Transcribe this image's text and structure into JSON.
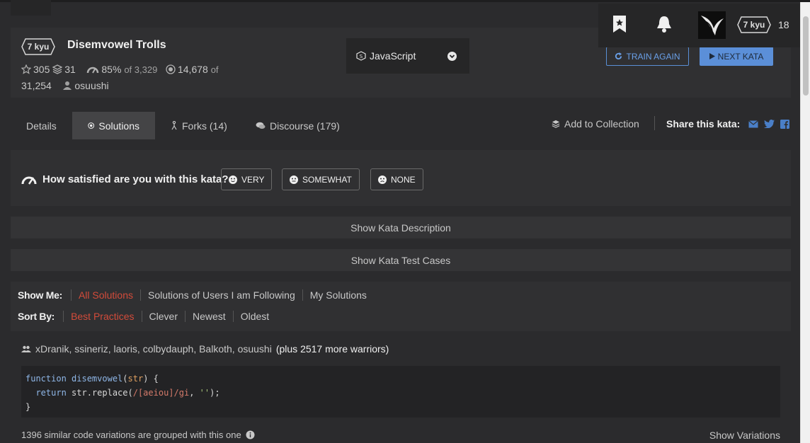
{
  "header": {
    "rank": "7 kyu",
    "title": "Disemvowel Trolls",
    "stars": "305",
    "collections": "31",
    "satisfaction_pct": "85%",
    "satisfaction_of": "of 3,329",
    "completed": "14,678",
    "completed_of": "of",
    "total": "31,254",
    "author": "osuushi",
    "language": "JavaScript",
    "train_again": "TRAIN AGAIN",
    "next_kata": "NEXT KATA"
  },
  "user": {
    "rank": "7 kyu",
    "honor": "18"
  },
  "tabs": [
    {
      "label": "Details"
    },
    {
      "label": "Solutions"
    },
    {
      "label": "Forks (14)"
    },
    {
      "label": "Discourse (179)"
    }
  ],
  "actions": {
    "add_collection": "Add to Collection",
    "share_label": "Share this kata:"
  },
  "satisfaction": {
    "question": "How satisfied are you with this kata?",
    "options": [
      "VERY",
      "SOMEWHAT",
      "NONE"
    ]
  },
  "show_description": "Show Kata Description",
  "show_tests": "Show Kata Test Cases",
  "filters": {
    "show_me_label": "Show Me:",
    "show_me": [
      "All Solutions",
      "Solutions of Users I am Following",
      "My Solutions"
    ],
    "sort_by_label": "Sort By:",
    "sort_by": [
      "Best Practices",
      "Clever",
      "Newest",
      "Oldest"
    ]
  },
  "solution": {
    "authors": "xDranik, ssineriz, laoris, colbydauph, Balkoth, osuushi",
    "more": "(plus 2517 more warriors)",
    "code": {
      "l1_kw": "function",
      "l1_fn": "disemvowel",
      "l1_open": "(",
      "l1_param": "str",
      "l1_close": ") {",
      "l2_kw": "  return",
      "l2_mid": " str.replace(",
      "l2_rx": "/[aeiou]/gi",
      "l2_sep": ", ",
      "l2_str": "''",
      "l2_end": ");",
      "l3": "}"
    },
    "variations": "1396 similar code variations are grouped with this one",
    "show_variations": "Show Variations"
  },
  "colors": {
    "accent_red": "#d24b3a",
    "accent_blue": "#5b8fd8",
    "panel": "#303032"
  }
}
